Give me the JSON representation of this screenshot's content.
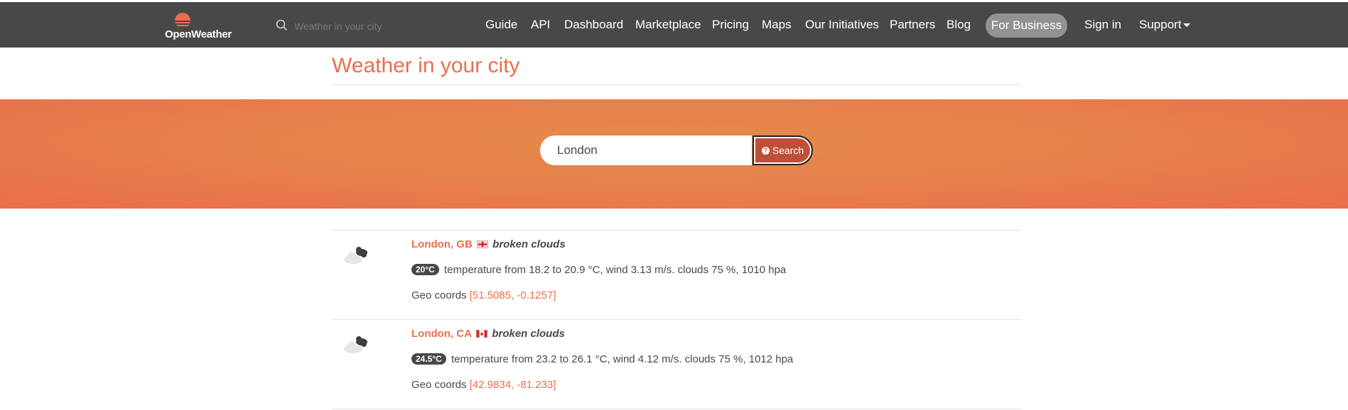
{
  "brand": {
    "name": "OpenWeather",
    "accent": "#eb6e4b",
    "nav_bg": "#48484a"
  },
  "nav_search": {
    "placeholder": "Weather in your city"
  },
  "nav": {
    "guide": "Guide",
    "api": "API",
    "dashboard": "Dashboard",
    "marketplace": "Marketplace",
    "pricing": "Pricing",
    "maps": "Maps",
    "initiatives": "Our Initiatives",
    "partners": "Partners",
    "blog": "Blog",
    "business": "For Business",
    "signin": "Sign in",
    "support": "Support"
  },
  "page": {
    "title": "Weather in your city"
  },
  "search": {
    "value": "London",
    "button_label": "Search",
    "button_icon": "question-circle-icon"
  },
  "results": [
    {
      "city": "London, GB",
      "flag": "gb-flag-icon",
      "description": "broken clouds",
      "temp_badge": "20°C",
      "details": "temperature from 18.2 to 20.9 °C, wind 3.13 m/s. clouds 75 %, 1010 hpa",
      "geo_label": "Geo coords",
      "geo_coords": "[51.5085, -0.1257]",
      "weather_icon": "broken-clouds-icon"
    },
    {
      "city": "London, CA",
      "flag": "ca-flag-icon",
      "description": "broken clouds",
      "temp_badge": "24.5°C",
      "details": "temperature from 23.2 to 26.1 °C, wind 4.12 m/s. clouds 75 %, 1012 hpa",
      "geo_label": "Geo coords",
      "geo_coords": "[42.9834, -81.233]",
      "weather_icon": "broken-clouds-icon"
    }
  ]
}
